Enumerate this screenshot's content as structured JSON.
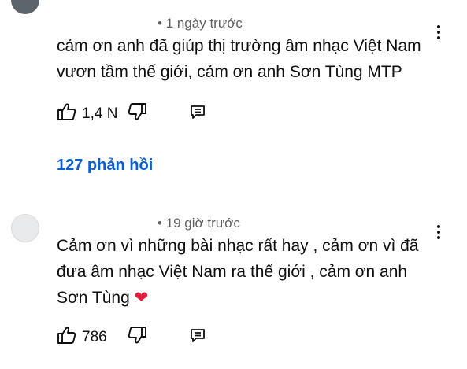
{
  "comments": [
    {
      "meta": "• 1 ngày trước",
      "text": "cảm ơn anh đã giúp thị trường âm nhạc Việt Nam\nvươn tầm thế giới, cảm ơn anh Sơn Tùng MTP",
      "likes": "1,4 N",
      "replies": "127 phản hồi"
    },
    {
      "meta": "• 19 giờ trước",
      "text": "Cảm ơn vì những bài nhạc rất hay , cảm ơn vì đã\nđưa âm nhạc Việt Nam ra thế giới , cảm ơn anh\nSơn Tùng ",
      "emoji": "❤",
      "likes": "786"
    }
  ],
  "icons": {
    "like": "thumbs-up-icon",
    "dislike": "thumbs-down-icon",
    "reply": "reply-icon",
    "more": "more-vertical-icon"
  },
  "colors": {
    "link": "#065fd4",
    "meta": "#606060",
    "heart": "#e01e3c"
  }
}
